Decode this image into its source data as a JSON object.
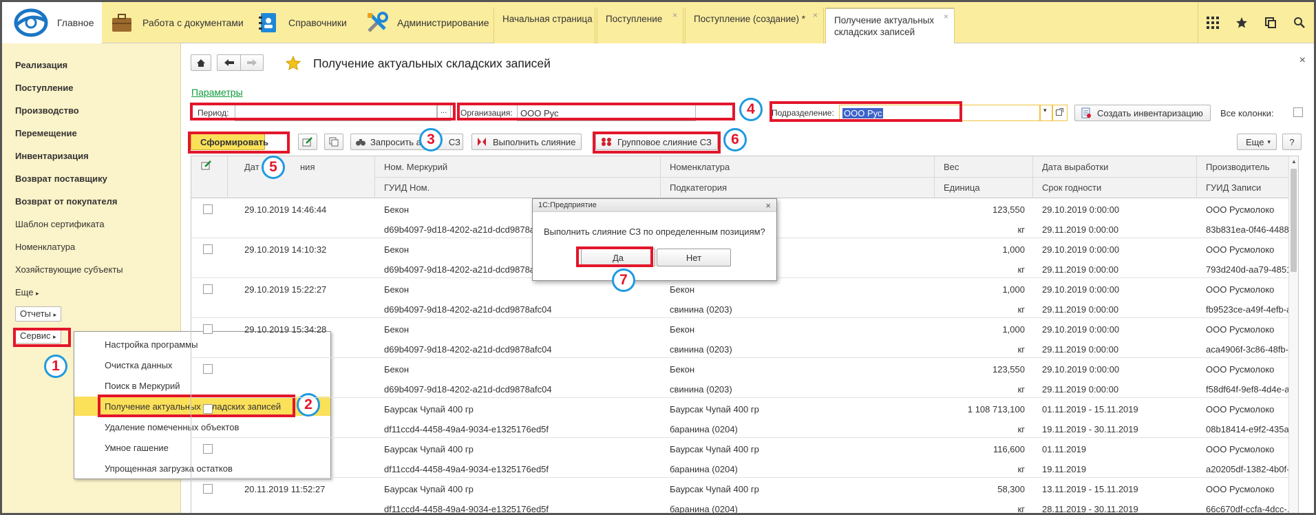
{
  "topbar": {
    "home": "Главное",
    "sections": [
      "Работа с документами",
      "Справочники",
      "Администрирование"
    ],
    "tabs": [
      "Начальная страница",
      "Поступление",
      "Поступление (создание) *",
      "Получение актуальных складских записей"
    ]
  },
  "sidebar": {
    "items": [
      "Реализация",
      "Поступление",
      "Производство",
      "Перемещение",
      "Инвентаризация",
      "Возврат поставщику",
      "Возврат от покупателя",
      "Шаблон сертификата",
      "Номенклатура",
      "Хозяйствующие субъекты",
      "Еще"
    ],
    "reports": "Отчеты",
    "service": "Сервис"
  },
  "service_menu": {
    "items": [
      "Настройка программы",
      "Очистка данных",
      "Поиск в Меркурий",
      "Получение актуальных складских записей",
      "Удаление помеченных объектов",
      "Умное гашение",
      "Упрощенная загрузка остатков"
    ]
  },
  "page": {
    "title": "Получение актуальных складских записей",
    "params_link": "Параметры",
    "period_label": "Период:",
    "period_value": "",
    "ellipsis": "...",
    "org_label": "Организация:",
    "org_value": "ООО  Рус",
    "dept_label": "Подразделение:",
    "dept_value": "ООО  Рус",
    "create_inv": "Создать инвентаризацию",
    "all_columns": "Все колонки:",
    "close": "×"
  },
  "toolbar": {
    "form": "Сформировать",
    "request": "Запросить а",
    "request_tail": "СЗ",
    "merge": "Выполнить слияние",
    "group_merge": "Групповое слияние СЗ",
    "more": "Еще",
    "help": "?"
  },
  "columns": {
    "date_a": "Дат",
    "date_b": "ния",
    "mercury_no": "Ном. Меркурий",
    "guid_nom": "ГУИД Ном.",
    "nomenclature": "Номенклатура",
    "subcategory": "Подкатегория",
    "weight": "Вес",
    "unit": "Единица",
    "prod_date": "Дата выработки",
    "shelf": "Срок годности",
    "producer": "Производитель",
    "guid_rec": "ГУИД Записи"
  },
  "rows": [
    {
      "date": "29.10.2019 14:46:44",
      "mercury": "Бекон",
      "guid": "d69b4097-9d18-4202-a21d-dcd9878afc04",
      "nom": "",
      "sub": "",
      "weight": "123,550",
      "unit": "кг",
      "prod": "29.10.2019 0:00:00",
      "shelf": "29.11.2019 0:00:00",
      "producer": "ООО Русмолоко",
      "guidrec": "83b831ea-0f46-4488-..."
    },
    {
      "date": "29.10.2019 14:10:32",
      "mercury": "Бекон",
      "guid": "d69b4097-9d18-4202-a21d-dcd9878afc04",
      "nom": "",
      "sub": "",
      "weight": "1,000",
      "unit": "кг",
      "prod": "29.10.2019 0:00:00",
      "shelf": "29.11.2019 0:00:00",
      "producer": "ООО Русмолоко",
      "guidrec": "793d240d-aa79-4851..."
    },
    {
      "date": "29.10.2019 15:22:27",
      "mercury": "Бекон",
      "guid": "d69b4097-9d18-4202-a21d-dcd9878afc04",
      "nom": "Бекон",
      "sub": "свинина (0203)",
      "weight": "1,000",
      "unit": "кг",
      "prod": "29.10.2019 0:00:00",
      "shelf": "29.11.2019 0:00:00",
      "producer": "ООО Русмолоко",
      "guidrec": "fb9523ce-a49f-4efb-a..."
    },
    {
      "date": "29.10.2019 15:34:28",
      "mercury": "Бекон",
      "guid": "d69b4097-9d18-4202-a21d-dcd9878afc04",
      "nom": "Бекон",
      "sub": "свинина (0203)",
      "weight": "1,000",
      "unit": "кг",
      "prod": "29.10.2019 0:00:00",
      "shelf": "29.11.2019 0:00:00",
      "producer": "ООО Русмолоко",
      "guidrec": "aca4906f-3c86-48fb-..."
    },
    {
      "date": "",
      "mercury": "Бекон",
      "guid": "d69b4097-9d18-4202-a21d-dcd9878afc04",
      "nom": "Бекон",
      "sub": "свинина (0203)",
      "weight": "123,550",
      "unit": "кг",
      "prod": "29.10.2019 0:00:00",
      "shelf": "29.11.2019 0:00:00",
      "producer": "ООО Русмолоко",
      "guidrec": "f58df64f-9ef8-4d4e-a..."
    },
    {
      "date": "",
      "mercury": "Баурсак Чупай 400 гр",
      "guid": "df11ccd4-4458-49a4-9034-e1325176ed5f",
      "nom": "Баурсак Чупай 400 гр",
      "sub": "баранина (0204)",
      "weight": "1 108 713,100",
      "unit": "кг",
      "prod": "01.11.2019 - 15.11.2019",
      "shelf": "19.11.2019 - 30.11.2019",
      "producer": "ООО Русмолоко",
      "guidrec": "08b18414-e9f2-435a-..."
    },
    {
      "date": "",
      "mercury": "Баурсак Чупай 400 гр",
      "guid": "df11ccd4-4458-49a4-9034-e1325176ed5f",
      "nom": "Баурсак Чупай 400 гр",
      "sub": "баранина (0204)",
      "weight": "116,600",
      "unit": "кг",
      "prod": "01.11.2019",
      "shelf": "19.11.2019",
      "producer": "ООО Русмолоко",
      "guidrec": "a20205df-1382-4b0f-..."
    },
    {
      "date": "20.11.2019 11:52:27",
      "mercury": "Баурсак Чупай 400 гр",
      "guid": "df11ccd4-4458-49a4-9034-e1325176ed5f",
      "nom": "Баурсак Чупай 400 гр",
      "sub": "баранина (0204)",
      "weight": "58,300",
      "unit": "кг",
      "prod": "13.11.2019 - 15.11.2019",
      "shelf": "28.11.2019 - 30.11.2019",
      "producer": "ООО Русмолоко",
      "guidrec": "66c670df-ccfa-4dcc-..."
    }
  ],
  "dialog": {
    "title": "1С:Предприятие",
    "message": "Выполнить слияние СЗ по определенным позициям?",
    "yes": "Да",
    "no": "Нет"
  },
  "callouts": [
    "1",
    "2",
    "3",
    "4",
    "5",
    "6",
    "7"
  ],
  "icons": [
    "logo-icon",
    "briefcase-icon",
    "address-book-icon",
    "tools-icon",
    "grid-icon",
    "star-icon",
    "history-icon",
    "search-icon",
    "home-icon",
    "back-arrow-icon",
    "forward-arrow-icon",
    "favorite-star-icon",
    "refresh-icon",
    "edit-icon",
    "copy-icon",
    "binoculars-icon",
    "merge-icon",
    "group-merge-icon",
    "document-icon",
    "close-icon"
  ]
}
